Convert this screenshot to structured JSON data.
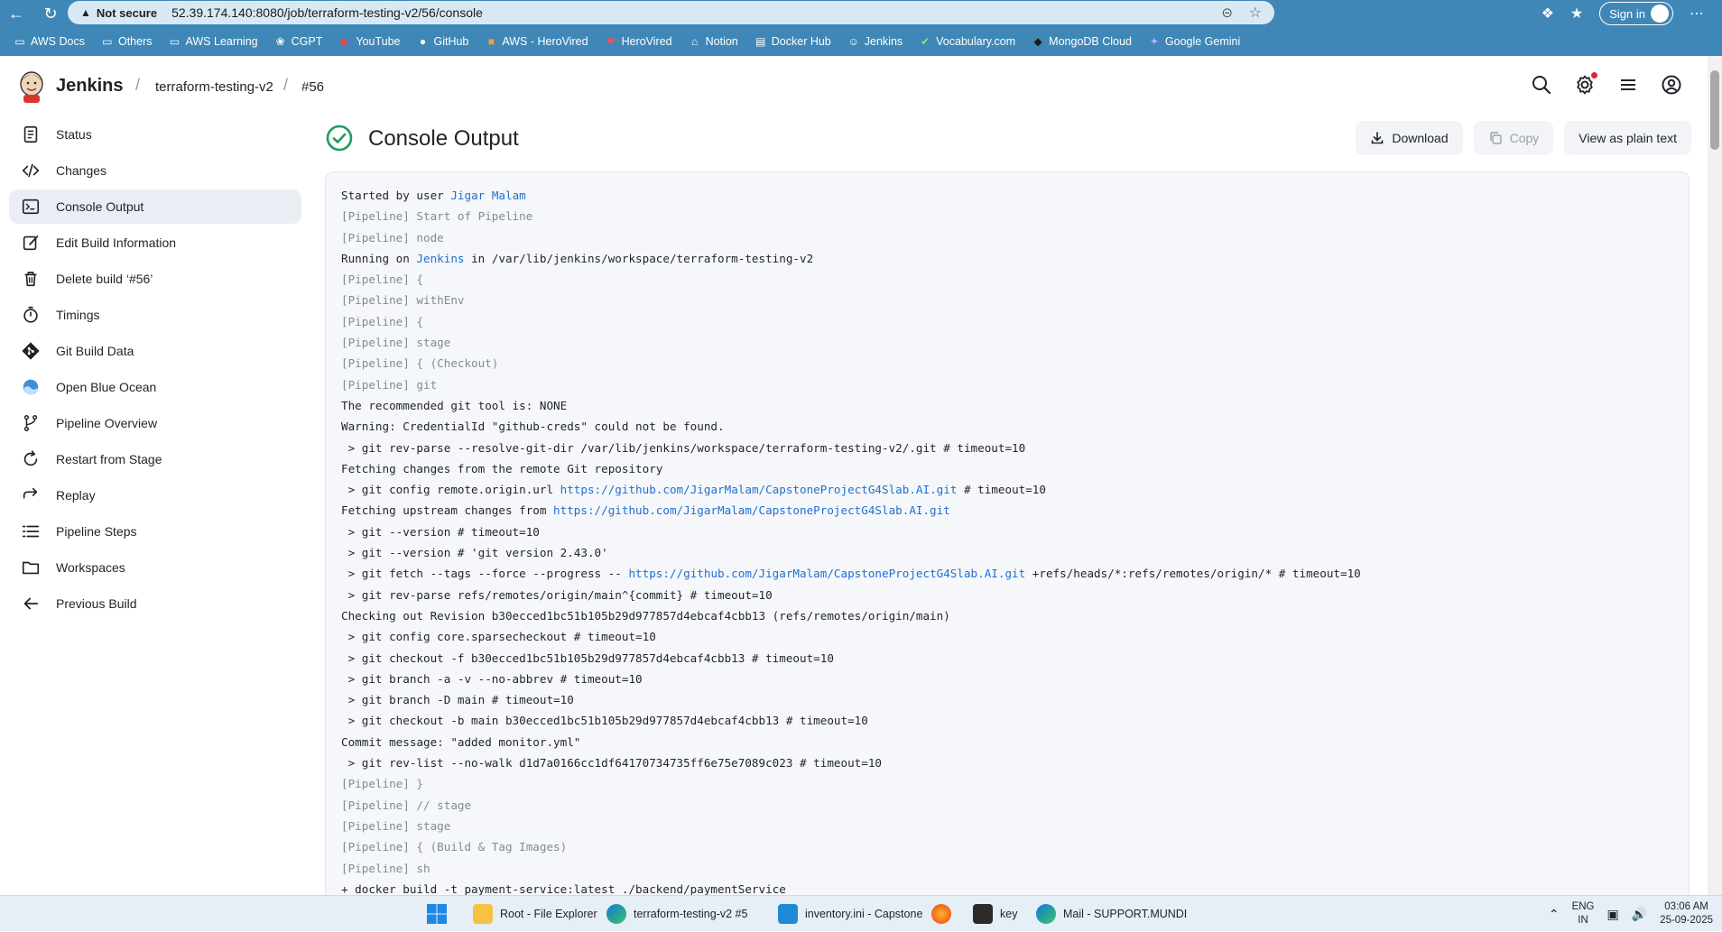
{
  "browser": {
    "security_label": "Not secure",
    "url": "52.39.174.140:8080/job/terraform-testing-v2/56/console",
    "sign_in": "Sign in",
    "bookmarks": [
      {
        "label": "AWS Docs",
        "icon": "folder-icon"
      },
      {
        "label": "Others",
        "icon": "folder-icon"
      },
      {
        "label": "AWS Learning",
        "icon": "folder-icon"
      },
      {
        "label": "CGPT",
        "icon": "openai-icon"
      },
      {
        "label": "YouTube",
        "icon": "youtube-icon"
      },
      {
        "label": "GitHub",
        "icon": "github-icon"
      },
      {
        "label": "AWS - HeroVired",
        "icon": "aws-icon"
      },
      {
        "label": "HeroVired",
        "icon": "herovired-icon"
      },
      {
        "label": "Notion",
        "icon": "notion-icon"
      },
      {
        "label": "Docker Hub",
        "icon": "docker-icon"
      },
      {
        "label": "Jenkins",
        "icon": "jenkins-icon"
      },
      {
        "label": "Vocabulary.com",
        "icon": "vocabulary-icon"
      },
      {
        "label": "MongoDB Cloud",
        "icon": "mongodb-icon"
      },
      {
        "label": "Google Gemini",
        "icon": "gemini-icon"
      }
    ]
  },
  "header": {
    "brand": "Jenkins",
    "breadcrumb": [
      "terraform-testing-v2",
      "#56"
    ]
  },
  "sidebar": {
    "items": [
      {
        "label": "Status",
        "icon": "document-icon"
      },
      {
        "label": "Changes",
        "icon": "code-icon"
      },
      {
        "label": "Console Output",
        "icon": "terminal-icon",
        "active": true
      },
      {
        "label": "Edit Build Information",
        "icon": "edit-icon"
      },
      {
        "label": "Delete build ‘#56’",
        "icon": "trash-icon"
      },
      {
        "label": "Timings",
        "icon": "stopwatch-icon"
      },
      {
        "label": "Git Build Data",
        "icon": "git-icon"
      },
      {
        "label": "Open Blue Ocean",
        "icon": "blue-ocean-icon"
      },
      {
        "label": "Pipeline Overview",
        "icon": "pipeline-icon"
      },
      {
        "label": "Restart from Stage",
        "icon": "restart-icon"
      },
      {
        "label": "Replay",
        "icon": "replay-icon"
      },
      {
        "label": "Pipeline Steps",
        "icon": "list-icon"
      },
      {
        "label": "Workspaces",
        "icon": "folder-icon"
      },
      {
        "label": "Previous Build",
        "icon": "arrow-left-icon"
      }
    ]
  },
  "main": {
    "title": "Console Output",
    "actions": {
      "download": "Download",
      "copy": "Copy",
      "plain": "View as plain text"
    }
  },
  "console": {
    "lines": [
      [
        {
          "t": "Started by user "
        },
        {
          "t": "Jigar Malam",
          "k": "link"
        }
      ],
      [
        {
          "t": "[Pipeline] Start of Pipeline",
          "k": "pl"
        }
      ],
      [
        {
          "t": "[Pipeline] node",
          "k": "pl"
        }
      ],
      [
        {
          "t": "Running on "
        },
        {
          "t": "Jenkins",
          "k": "link"
        },
        {
          "t": " in /var/lib/jenkins/workspace/terraform-testing-v2"
        }
      ],
      [
        {
          "t": "[Pipeline] {",
          "k": "pl"
        }
      ],
      [
        {
          "t": "[Pipeline] withEnv",
          "k": "pl"
        }
      ],
      [
        {
          "t": "[Pipeline] {",
          "k": "pl"
        }
      ],
      [
        {
          "t": "[Pipeline] stage",
          "k": "pl"
        }
      ],
      [
        {
          "t": "[Pipeline] { (Checkout)",
          "k": "pl"
        }
      ],
      [
        {
          "t": "[Pipeline] git",
          "k": "pl"
        }
      ],
      [
        {
          "t": "The recommended git tool is: NONE"
        }
      ],
      [
        {
          "t": "Warning: CredentialId \"github-creds\" could not be found."
        }
      ],
      [
        {
          "t": " > git rev-parse --resolve-git-dir /var/lib/jenkins/workspace/terraform-testing-v2/.git # timeout=10"
        }
      ],
      [
        {
          "t": "Fetching changes from the remote Git repository"
        }
      ],
      [
        {
          "t": " > git config remote.origin.url "
        },
        {
          "t": "https://github.com/JigarMalam/CapstoneProjectG4Slab.AI.git",
          "k": "link"
        },
        {
          "t": " # timeout=10"
        }
      ],
      [
        {
          "t": "Fetching upstream changes from "
        },
        {
          "t": "https://github.com/JigarMalam/CapstoneProjectG4Slab.AI.git",
          "k": "link"
        }
      ],
      [
        {
          "t": " > git --version # timeout=10"
        }
      ],
      [
        {
          "t": " > git --version # 'git version 2.43.0'"
        }
      ],
      [
        {
          "t": " > git fetch --tags --force --progress -- "
        },
        {
          "t": "https://github.com/JigarMalam/CapstoneProjectG4Slab.AI.git",
          "k": "link"
        },
        {
          "t": " +refs/heads/*:refs/remotes/origin/* # timeout=10"
        }
      ],
      [
        {
          "t": " > git rev-parse refs/remotes/origin/main^{commit} # timeout=10"
        }
      ],
      [
        {
          "t": "Checking out Revision b30ecced1bc51b105b29d977857d4ebcaf4cbb13 (refs/remotes/origin/main)"
        }
      ],
      [
        {
          "t": " > git config core.sparsecheckout # timeout=10"
        }
      ],
      [
        {
          "t": " > git checkout -f b30ecced1bc51b105b29d977857d4ebcaf4cbb13 # timeout=10"
        }
      ],
      [
        {
          "t": " > git branch -a -v --no-abbrev # timeout=10"
        }
      ],
      [
        {
          "t": " > git branch -D main # timeout=10"
        }
      ],
      [
        {
          "t": " > git checkout -b main b30ecced1bc51b105b29d977857d4ebcaf4cbb13 # timeout=10"
        }
      ],
      [
        {
          "t": "Commit message: \"added monitor.yml\""
        }
      ],
      [
        {
          "t": " > git rev-list --no-walk d1d7a0166cc1df64170734735ff6e75e7089c023 # timeout=10"
        }
      ],
      [
        {
          "t": "[Pipeline] }",
          "k": "pl"
        }
      ],
      [
        {
          "t": "[Pipeline] // stage",
          "k": "pl"
        }
      ],
      [
        {
          "t": "[Pipeline] stage",
          "k": "pl"
        }
      ],
      [
        {
          "t": "[Pipeline] { (Build & Tag Images)",
          "k": "pl"
        }
      ],
      [
        {
          "t": "[Pipeline] sh",
          "k": "pl"
        }
      ],
      [
        {
          "t": "+ docker build -t payment-service:latest ./backend/paymentService"
        }
      ]
    ]
  },
  "taskbar": {
    "items": [
      {
        "label": "Root - File Explorer",
        "icon": "file-explorer-icon"
      },
      {
        "label": "terraform-testing-v2 #5",
        "icon": "edge-icon"
      },
      {
        "label": "inventory.ini - Capstone",
        "icon": "vscode-icon"
      },
      {
        "label": "",
        "icon": "firefox-icon"
      },
      {
        "label": "key",
        "icon": "terminal-icon"
      },
      {
        "label": "Mail - SUPPORT.MUNDI",
        "icon": "edge-icon"
      }
    ],
    "lang": [
      "ENG",
      "IN"
    ],
    "time": "03:06 AM",
    "date": "25-09-2025"
  },
  "colors": {
    "chrome": "#3f87b6",
    "link": "#1f6fd1",
    "pipeline_text": "#7f8b97",
    "success": "#1a9e5c"
  }
}
